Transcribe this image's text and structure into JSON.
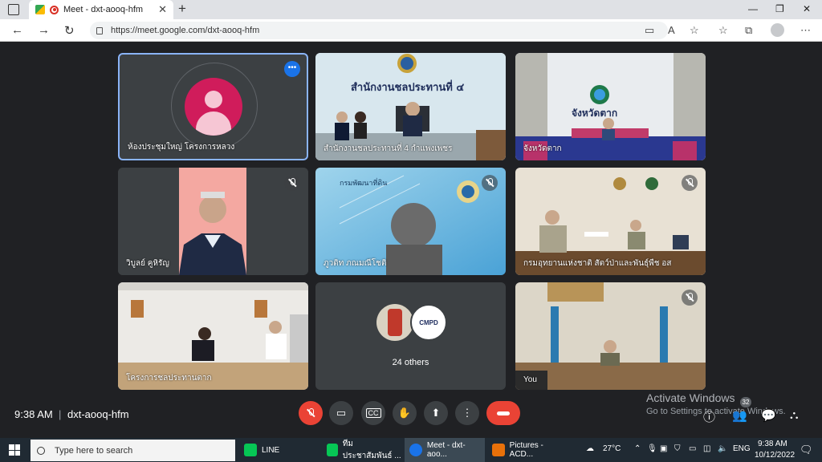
{
  "browser": {
    "tab_title": "Meet - dxt-aooq-hfm",
    "tab_close": "✕",
    "new_tab": "+",
    "url": "https://meet.google.com/dxt-aooq-hfm",
    "minimize": "—",
    "maximize": "❐",
    "close": "✕"
  },
  "tiles": [
    {
      "name": "ห้องประชุมใหญ่ โครงการหลวง",
      "kind": "avatar"
    },
    {
      "name": "สำนักงานชลประทานที่ 4 กำแพงเพชร",
      "kind": "video",
      "banner": "สำนักงานชลประทานที่ ๔"
    },
    {
      "name": "จังหวัดตาก",
      "kind": "video",
      "banner": "จังหวัดตาก"
    },
    {
      "name": "วิบูลย์ คูหิรัญ",
      "kind": "video",
      "muted": true
    },
    {
      "name": "ภูวดิท ภณมณีโชติ",
      "kind": "video",
      "muted": true
    },
    {
      "name": "กรมอุทยานแห่งชาติ สัตว์ป่าและพันธุ์พืช อส",
      "kind": "video",
      "muted": true
    },
    {
      "name": "โครงการชลประทานตาก",
      "kind": "video"
    },
    {
      "name": "24 others",
      "kind": "others",
      "logo_text": "CMPD"
    },
    {
      "name": "You",
      "kind": "video",
      "muted": true
    }
  ],
  "meeting": {
    "time": "9:38 AM",
    "separator": "|",
    "code": "dxt-aooq-hfm",
    "participants_count": "32"
  },
  "watermark": {
    "line1": "Activate Windows",
    "line2": "Go to Settings to activate Windows."
  },
  "taskbar": {
    "search_placeholder": "Type here to search",
    "apps": [
      {
        "label": "LINE",
        "color": "#06c755"
      },
      {
        "label": "ทีมประชาสัมพันธ์ ...",
        "color": "#06c755"
      },
      {
        "label": "Meet - dxt-aoo...",
        "color": "#1a73e8"
      },
      {
        "label": "Pictures - ACD...",
        "color": "#e8710a"
      }
    ],
    "weather": "27°C",
    "language": "ENG",
    "clock_time": "9:38 AM",
    "clock_date": "10/12/2022"
  },
  "colors": {
    "accent": "#8ab4f8",
    "danger": "#ea4335",
    "avatar": "#d01c5b"
  }
}
